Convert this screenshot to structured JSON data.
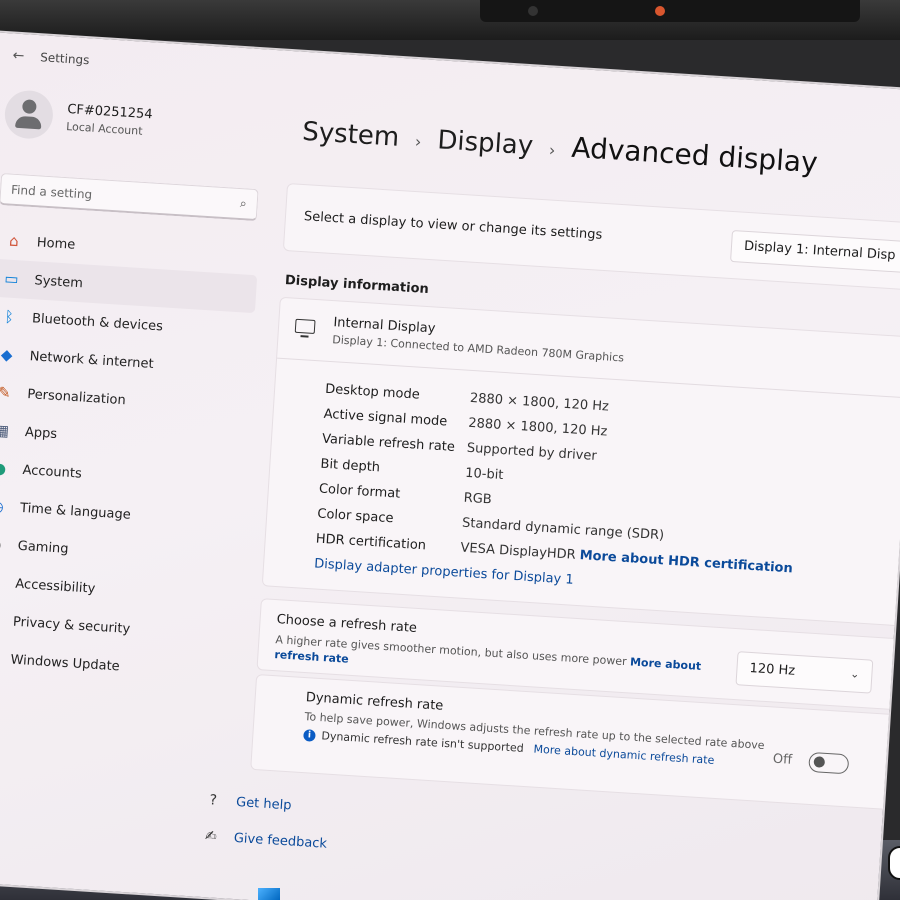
{
  "window": {
    "title": "Settings"
  },
  "profile": {
    "name": "CF#0251254",
    "account_type": "Local Account"
  },
  "search": {
    "placeholder": "Find a setting"
  },
  "nav": {
    "items": [
      {
        "label": "Home",
        "icon": "home-icon",
        "active": false
      },
      {
        "label": "System",
        "icon": "system-icon",
        "active": true
      },
      {
        "label": "Bluetooth & devices",
        "icon": "bluetooth-icon",
        "active": false
      },
      {
        "label": "Network & internet",
        "icon": "network-icon",
        "active": false
      },
      {
        "label": "Personalization",
        "icon": "brush-icon",
        "active": false
      },
      {
        "label": "Apps",
        "icon": "apps-icon",
        "active": false
      },
      {
        "label": "Accounts",
        "icon": "accounts-icon",
        "active": false
      },
      {
        "label": "Time & language",
        "icon": "time-icon",
        "active": false
      },
      {
        "label": "Gaming",
        "icon": "gaming-icon",
        "active": false
      },
      {
        "label": "Accessibility",
        "icon": "accessibility-icon",
        "active": false
      },
      {
        "label": "Privacy & security",
        "icon": "shield-icon",
        "active": false
      },
      {
        "label": "Windows Update",
        "icon": "update-icon",
        "active": false
      }
    ]
  },
  "breadcrumb": {
    "level1": "System",
    "level2": "Display",
    "current": "Advanced display"
  },
  "display_select": {
    "label": "Select a display to view or change its settings",
    "value": "Display 1: Internal Disp"
  },
  "display_info": {
    "section_title": "Display information",
    "name": "Internal Display",
    "subtitle": "Display 1: Connected to AMD Radeon 780M Graphics",
    "specs": [
      {
        "label": "Desktop mode",
        "value": "2880 × 1800, 120 Hz"
      },
      {
        "label": "Active signal mode",
        "value": "2880 × 1800, 120 Hz"
      },
      {
        "label": "Variable refresh rate",
        "value": "Supported by driver"
      },
      {
        "label": "Bit depth",
        "value": "10-bit"
      },
      {
        "label": "Color format",
        "value": "RGB"
      },
      {
        "label": "Color space",
        "value": "Standard dynamic range (SDR)"
      },
      {
        "label": "HDR certification",
        "value": "VESA DisplayHDR",
        "link": "More about HDR certification"
      }
    ],
    "adapter_link": "Display adapter properties for Display 1"
  },
  "refresh_rate": {
    "title": "Choose a refresh rate",
    "description": "A higher rate gives smoother motion, but also uses more power",
    "link": "More about refresh rate",
    "value": "120 Hz"
  },
  "dynamic_refresh": {
    "title": "Dynamic refresh rate",
    "description": "To help save power, Windows adjusts the refresh rate up to the selected rate above",
    "note": "Dynamic refresh rate isn't supported",
    "link": "More about dynamic refresh rate",
    "toggle_label": "Off",
    "toggle_state": false
  },
  "footer": {
    "help": "Get help",
    "feedback": "Give feedback"
  },
  "colors": {
    "accent": "#0067c0",
    "link": "#0b4a9a",
    "background": "#f3ecf1"
  }
}
